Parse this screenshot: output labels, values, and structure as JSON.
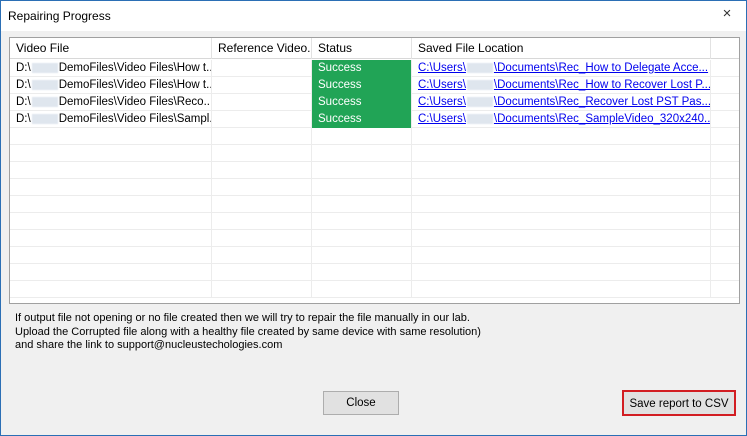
{
  "window": {
    "title": "Repairing Progress",
    "close_glyph": "×"
  },
  "table": {
    "columns": [
      "Video File",
      "Reference Video...",
      "Status",
      "Saved File Location"
    ],
    "rows": [
      {
        "video_prefix": "D:\\",
        "video_suffix": "DemoFiles\\Video Files\\How t...",
        "reference": "",
        "status": "Success",
        "loc_prefix": "C:\\Users\\",
        "loc_suffix": "\\Documents\\Rec_How to Delegate Acce..."
      },
      {
        "video_prefix": "D:\\",
        "video_suffix": "DemoFiles\\Video Files\\How t...",
        "reference": "",
        "status": "Success",
        "loc_prefix": "C:\\Users\\",
        "loc_suffix": "\\Documents\\Rec_How to Recover Lost P..."
      },
      {
        "video_prefix": "D:\\",
        "video_suffix": "DemoFiles\\Video Files\\Reco...",
        "reference": "",
        "status": "Success",
        "loc_prefix": "C:\\Users\\",
        "loc_suffix": "\\Documents\\Rec_Recover Lost PST Pas..."
      },
      {
        "video_prefix": "D:\\",
        "video_suffix": "DemoFiles\\Video Files\\Sampl...",
        "reference": "",
        "status": "Success",
        "loc_prefix": "C:\\Users\\",
        "loc_suffix": "\\Documents\\Rec_SampleVideo_320x240..."
      }
    ],
    "status_color": "#21a456"
  },
  "note": {
    "line1": "If output file not opening or no file created then we will try to repair the file manually in our lab.",
    "line2": "Upload the Corrupted file along with a healthy file created by same device with same resolution)",
    "line3": " and share the link to support@nucleustechologies.com"
  },
  "buttons": {
    "close_label": "Close",
    "save_label": "Save report to CSV"
  }
}
